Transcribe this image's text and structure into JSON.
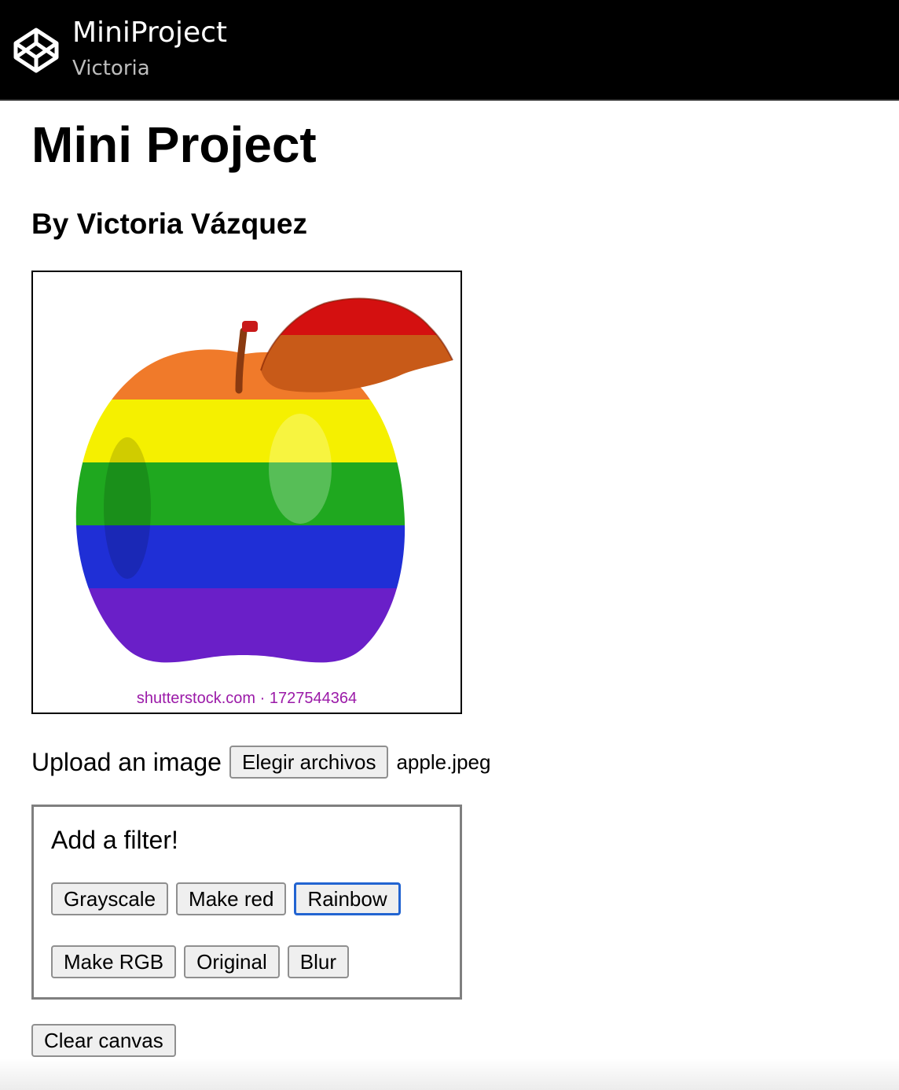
{
  "header": {
    "title": "MiniProject",
    "subtitle": "Victoria",
    "logo_icon": "codepen-cube-icon"
  },
  "page": {
    "title": "Mini Project",
    "byline": "By Victoria Vázquez"
  },
  "canvas": {
    "watermark": "shutterstock.com · 1727544364",
    "image_description_icon": "rainbow-apple-image",
    "stripe_colors": [
      "#e41b1b",
      "#f07a2a",
      "#f5f000",
      "#1fa81f",
      "#1f2fd6",
      "#6a1fc8"
    ]
  },
  "upload": {
    "label": "Upload an image",
    "button_label": "Elegir archivos",
    "file_name": "apple.jpeg"
  },
  "filters": {
    "title": "Add a filter!",
    "row1": [
      "Grayscale",
      "Make red",
      "Rainbow"
    ],
    "row2": [
      "Make RGB",
      "Original",
      "Blur"
    ],
    "active": "Rainbow"
  },
  "clear_label": "Clear canvas",
  "colors": {
    "topbar": "#000000",
    "active_border": "#2264d1"
  }
}
